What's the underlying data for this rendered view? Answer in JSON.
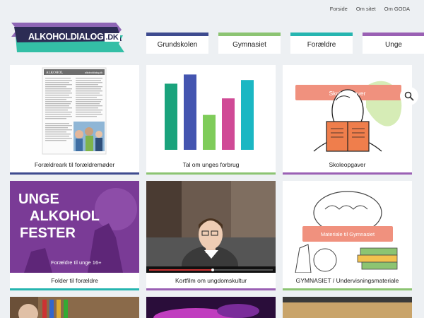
{
  "top_links": [
    "Forside",
    "Om sitet",
    "Om GODA"
  ],
  "logo": {
    "main": "ALKOHOLDIALOG",
    "suffix": ".DK"
  },
  "nav": [
    {
      "label": "Grundskolen",
      "color": "#3e4b8f"
    },
    {
      "label": "Gymnasiet",
      "color": "#8cc472"
    },
    {
      "label": "Forældre",
      "color": "#26b5b0"
    },
    {
      "label": "Unge",
      "color": "#9a60b4"
    }
  ],
  "cards": [
    {
      "caption": "Forældreark til forældremøder",
      "accent": "#3e4b8f"
    },
    {
      "caption": "Tal om unges forbrug",
      "accent": "#8cc472"
    },
    {
      "caption": "Skoleopgaver",
      "accent": "#9a60b4",
      "banner": "Skoleopgaver"
    },
    {
      "caption": "Folder til forældre",
      "accent": "#26b5b0",
      "poster": {
        "line1": "UNGE",
        "line2": "ALKOHOL",
        "line3": "FESTER",
        "sub": "Forældre til unge 16+"
      }
    },
    {
      "caption": "Kortfilm om ungdomskultur",
      "accent": "#9a60b4"
    },
    {
      "caption": "GYMNASIET / Undervisningsmateriale",
      "accent": "#8cc472",
      "banner": "Materiale til Gymnasiet"
    }
  ],
  "doc_preview": {
    "title": "ALKOHOL",
    "site": "alkoholdialog.dk"
  },
  "bars_chart": {
    "values": [
      0.72,
      0.82,
      0.38,
      0.56,
      0.76
    ],
    "colors": [
      "#1aa37c",
      "#4455b0",
      "#7fcc5a",
      "#d04a96",
      "#1bb7c3"
    ]
  },
  "colors": {
    "logo_purple": "#8e66b5",
    "logo_teal": "#34bfa6",
    "banner_coral": "#f0917e"
  }
}
